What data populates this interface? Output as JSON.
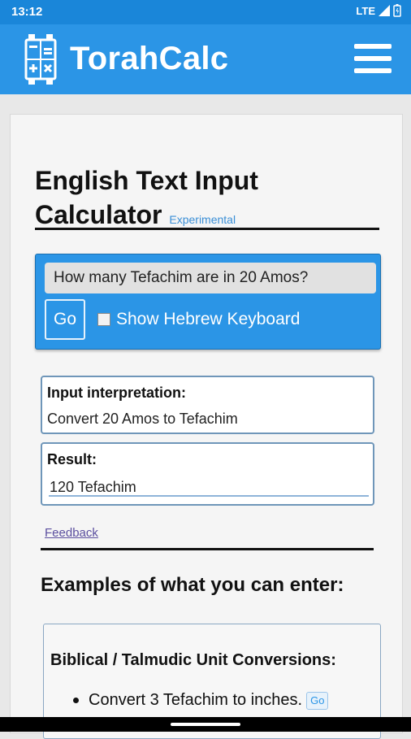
{
  "status": {
    "time": "13:12",
    "network": "LTE"
  },
  "app": {
    "title": "TorahCalc"
  },
  "page": {
    "heading_line1": "English Text Input",
    "heading_line2": "Calculator",
    "badge": "Experimental"
  },
  "input": {
    "query": "How many Tefachim are in 20 Amos?",
    "go_label": "Go",
    "keyboard_label": "Show Hebrew Keyboard"
  },
  "interpretation": {
    "label": "Input interpretation:",
    "value": "Convert 20 Amos to Tefachim"
  },
  "result": {
    "label": "Result:",
    "value": "120 Tefachim"
  },
  "feedback": "Feedback",
  "examples": {
    "title": "Examples of what you can enter:",
    "category": "Biblical / Talmudic Unit Conversions:",
    "items": [
      {
        "text": "Convert 3 Tefachim to inches.",
        "go_label": "Go"
      }
    ]
  },
  "colors": {
    "brand": "#2b95e6",
    "statusbar": "#1a86d9"
  }
}
